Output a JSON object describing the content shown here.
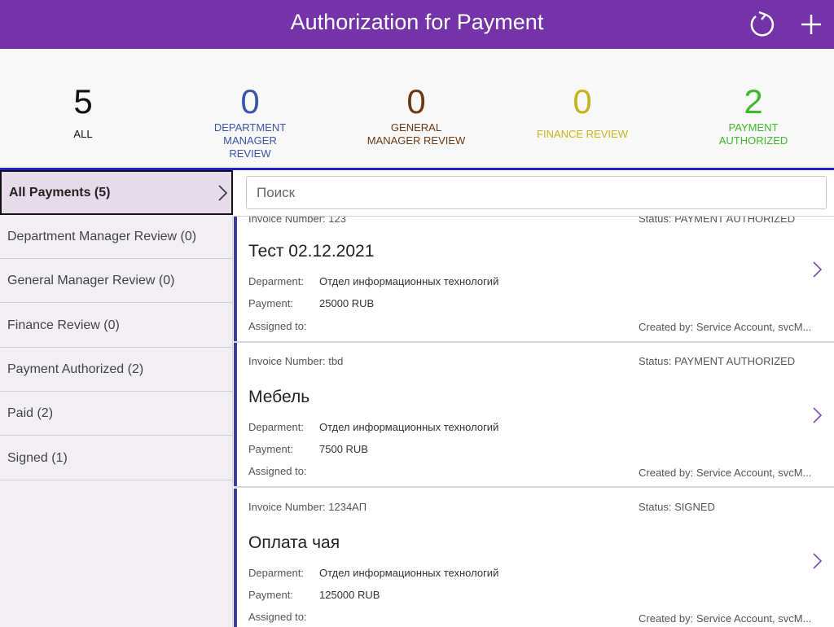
{
  "header": {
    "title": "Authorization for Payment",
    "refresh_icon": "refresh-icon",
    "add_icon": "plus-icon"
  },
  "stats": [
    {
      "number": "5",
      "label": "ALL",
      "color": "#111111"
    },
    {
      "number": "0",
      "label": "DEPARTMENT MANAGER REVIEW",
      "color": "#3a56a6"
    },
    {
      "number": "0",
      "label": "GENERAL MANAGER REVIEW",
      "color": "#6b3a14"
    },
    {
      "number": "0",
      "label": "FINANCE REVIEW",
      "color": "#c7b41a"
    },
    {
      "number": "2",
      "label": "PAYMENT AUTHORIZED",
      "color": "#3fb82b"
    }
  ],
  "sidebar": {
    "items": [
      {
        "label": "All Payments (5)"
      },
      {
        "label": "Department Manager Review (0)"
      },
      {
        "label": "General Manager Review (0)"
      },
      {
        "label": "Finance Review (0)"
      },
      {
        "label": "Payment Authorized (2)"
      },
      {
        "label": "Paid (2)"
      },
      {
        "label": "Signed (1)"
      }
    ]
  },
  "search": {
    "placeholder": "Поиск"
  },
  "cards": [
    {
      "invoice": "Invoice Number: 123",
      "status": "Status: PAYMENT AUTHORIZED",
      "name": "Тест 02.12.2021",
      "department_label": "Deparment:",
      "department": "Отдел информационных технологий",
      "payment_label": "Payment:",
      "payment": "25000 RUB",
      "assigned_label": "Assigned to:",
      "created": "Created by: Service Account, svcM..."
    },
    {
      "invoice": "Invoice Number: tbd",
      "status": "Status: PAYMENT AUTHORIZED",
      "name": "Мебель",
      "department_label": "Deparment:",
      "department": "Отдел информационных технологий",
      "payment_label": "Payment:",
      "payment": "7500 RUB",
      "assigned_label": "Assigned to:",
      "created": "Created by: Service Account, svcM..."
    },
    {
      "invoice": "Invoice Number: 1234АП",
      "status": "Status: SIGNED",
      "name": "Оплата чая",
      "department_label": "Deparment:",
      "department": "Отдел информационных технологий",
      "payment_label": "Payment:",
      "payment": "125000 RUB",
      "assigned_label": "Assigned to:",
      "created": "Created by: Service Account, svcM..."
    }
  ],
  "colors": {
    "accent": "#7433a8",
    "card_bar": "#3d3d9c",
    "chevron": "#7a4bb0"
  }
}
